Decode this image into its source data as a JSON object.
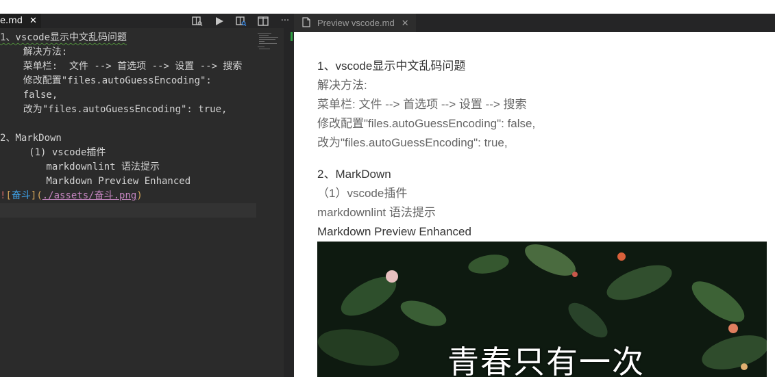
{
  "colors": {
    "editor_bg": "#2b2b2b",
    "tabbar_bg": "#252526",
    "preview_bg": "#ffffff",
    "link": "#c586c0",
    "squiggle": "#4f8b3b"
  },
  "editor": {
    "tab_title": "e.md",
    "tab_close": "✕",
    "actions": [
      "open-preview-icon",
      "run-icon",
      "preview-side-icon",
      "split-editor-icon",
      "more-actions-icon"
    ],
    "more_label": "···",
    "lines": {
      "l1": "1、vscode显示中文乱码问题",
      "l2": "    解决方法:",
      "l3": "    菜单栏:  文件 --> 首选项 --> 设置 --> 搜索",
      "l4": "    修改配置\"files.autoGuessEncoding\":",
      "l5": "    false,",
      "l6": "    改为\"files.autoGuessEncoding\": true,",
      "l7": "2、MarkDown",
      "l8": "     (1) vscode插件",
      "l9": "        markdownlint 语法提示",
      "l10": "        Markdown Preview Enhanced"
    },
    "image_link": {
      "bang": "!",
      "open_bracket": "[",
      "alt": "奋斗",
      "close_bracket": "]",
      "open_paren": "(",
      "path": "./assets/奋斗.png",
      "close_paren": ")"
    }
  },
  "preview": {
    "tab_title": "Preview vscode.md",
    "tab_close": "✕",
    "lines": {
      "p1": "1、vscode显示中文乱码问题",
      "p2": "解决方法:",
      "p3": "菜单栏: 文件 --> 首选项 --> 设置 --> 搜索",
      "p4": "修改配置\"files.autoGuessEncoding\": false,",
      "p5": "改为\"files.autoGuessEncoding\": true,",
      "p6": "2、MarkDown",
      "p7": "（1）vscode插件",
      "p8": "markdownlint 语法提示",
      "p9": "Markdown Preview Enhanced"
    },
    "image_caption": "青春只有一次"
  }
}
